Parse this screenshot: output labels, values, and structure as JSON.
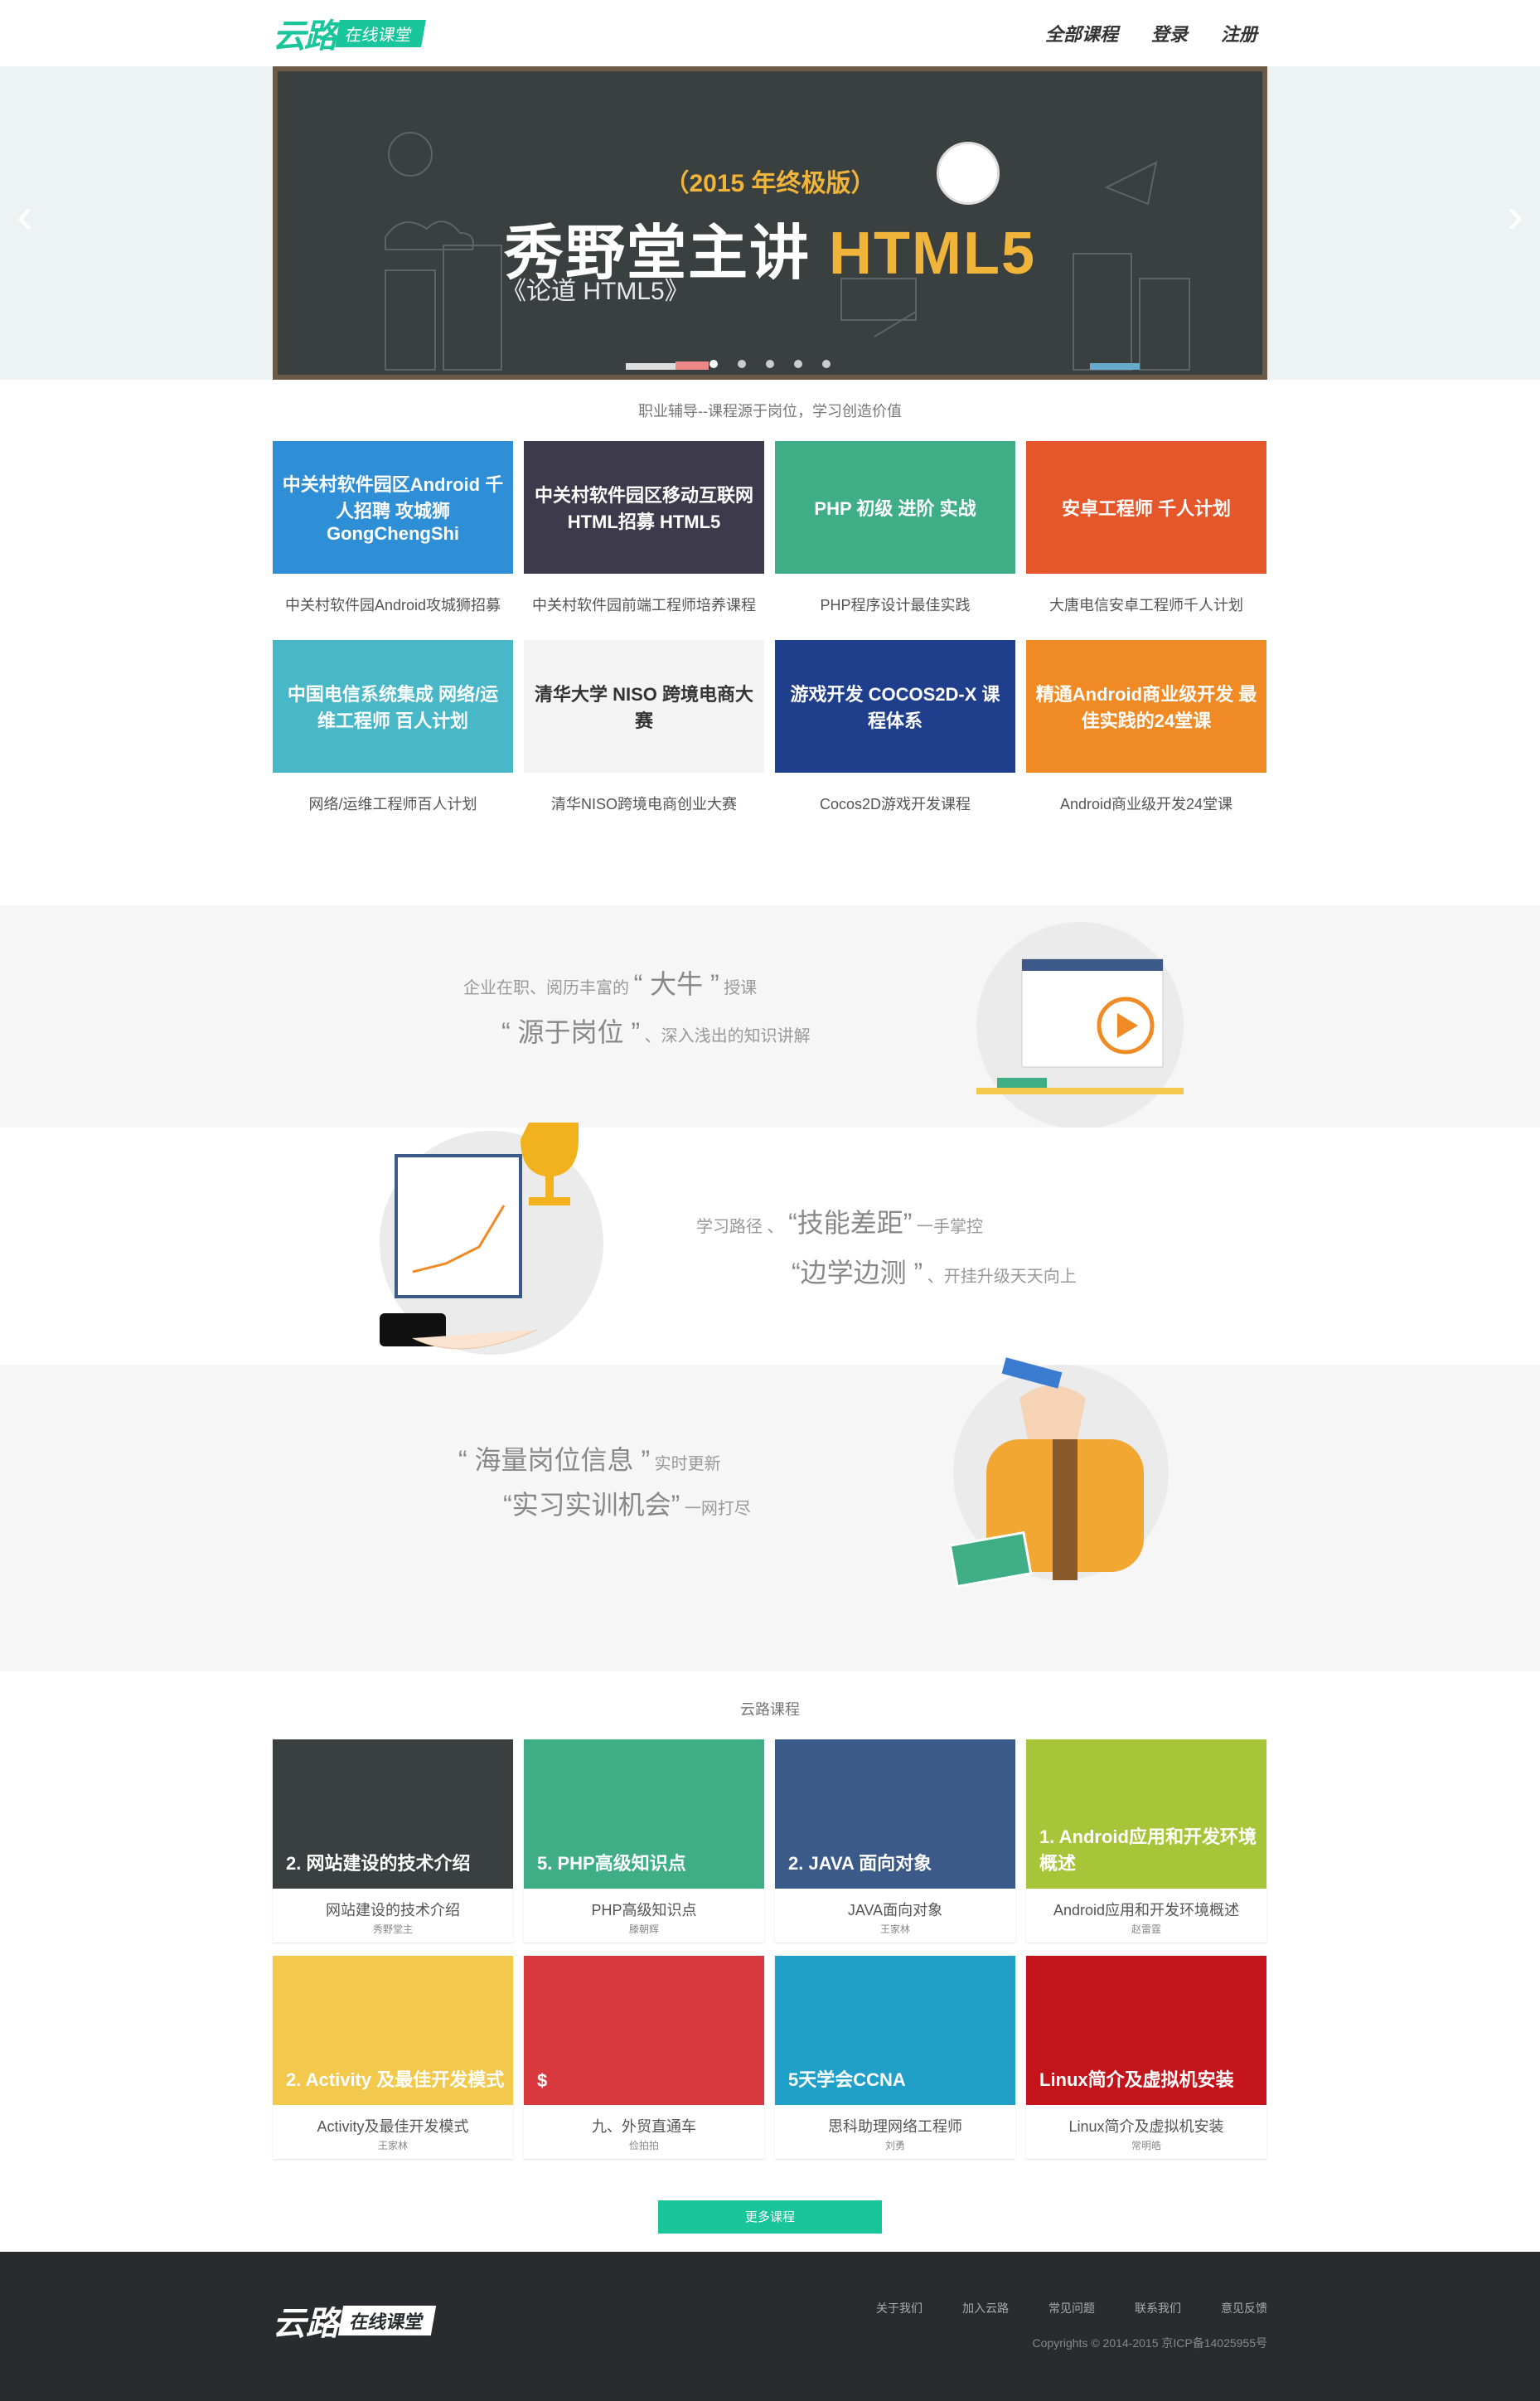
{
  "header": {
    "logo_main": "云路",
    "logo_tag": "在线课堂",
    "nav": [
      "全部课程",
      "登录",
      "注册"
    ]
  },
  "banner": {
    "edition": "（2015 年终极版）",
    "title_part1": "秀野堂主讲",
    "title_part2": "HTML5",
    "caption": "《论道 HTML5》",
    "dots": 5,
    "active_dot": 0
  },
  "career": {
    "title": "职业辅导--课程源于岗位，学习创造价值",
    "items": [
      {
        "label": "中关村软件园Android攻城狮招募",
        "thumb": "中关村软件园区Android 千人招聘 攻城狮 GongChengShi",
        "color": "#2e8fd6"
      },
      {
        "label": "中关村软件园前端工程师培养课程",
        "thumb": "中关村软件园区移动互联网HTML招募 HTML5",
        "color": "#3d3a4c"
      },
      {
        "label": "PHP程序设计最佳实践",
        "thumb": "PHP 初级 进阶 实战",
        "color": "#3fae86"
      },
      {
        "label": "大唐电信安卓工程师千人计划",
        "thumb": "安卓工程师 千人计划",
        "color": "#e5572a"
      },
      {
        "label": "网络/运维工程师百人计划",
        "thumb": "中国电信系统集成 网络/运维工程师 百人计划",
        "color": "#48b8c8"
      },
      {
        "label": "清华NISO跨境电商创业大赛",
        "thumb": "清华大学 NISO 跨境电商大赛",
        "color": "#f4f4f4"
      },
      {
        "label": "Cocos2D游戏开发课程",
        "thumb": "游戏开发 COCOS2D-X 课程体系",
        "color": "#1f3e8c"
      },
      {
        "label": "Android商业级开发24堂课",
        "thumb": "精通Android商业级开发 最佳实践的24堂课",
        "color": "#f08a24"
      }
    ]
  },
  "features": {
    "f1_line1_pre": "企业在职、阅历丰富的",
    "f1_line1_q": "“ 大牛 ”",
    "f1_line1_post": "授课",
    "f1_line2_q": "“ 源于岗位 ”",
    "f1_line2_post": "、深入浅出的知识讲解",
    "f2_line1_pre": "学习路径 、",
    "f2_line1_q": "“技能差距”",
    "f2_line1_post": "一手掌控",
    "f2_line2_q": "“边学边测 ”",
    "f2_line2_post": "、开挂升级天天向上",
    "f3_line1_q": "“ 海量岗位信息 ”",
    "f3_line1_post": "实时更新",
    "f3_line2_q": "“实习实训机会”",
    "f3_line2_post": "一网打尽"
  },
  "courses": {
    "title": "云路课程",
    "items": [
      {
        "name": "网站建设的技术介绍",
        "teacher": "秀野堂主",
        "thumb": "2. 网站建设的技术介绍",
        "color": "#3a3f40"
      },
      {
        "name": "PHP高级知识点",
        "teacher": "滕朝辉",
        "thumb": "5. PHP高级知识点",
        "color": "#3fae86"
      },
      {
        "name": "JAVA面向对象",
        "teacher": "王家林",
        "thumb": "2. JAVA 面向对象",
        "color": "#3b5a8a"
      },
      {
        "name": "Android应用和开发环境概述",
        "teacher": "赵雷霆",
        "thumb": "1. Android应用和开发环境概述",
        "color": "#a8c53a"
      },
      {
        "name": "Activity及最佳开发模式",
        "teacher": "王家林",
        "thumb": "2. Activity 及最佳开发模式",
        "color": "#f2c94c"
      },
      {
        "name": "九、外贸直通车",
        "teacher": "俭拍拍",
        "thumb": "$",
        "color": "#d8393e"
      },
      {
        "name": "思科助理网络工程师",
        "teacher": "刘勇",
        "thumb": "5天学会CCNA",
        "color": "#20a0c8"
      },
      {
        "name": "Linux简介及虚拟机安装",
        "teacher": "常明皓",
        "thumb": "Linux简介及虚拟机安装",
        "color": "#c4141b"
      }
    ],
    "more_label": "更多课程"
  },
  "footer": {
    "logo_main": "云路",
    "logo_tag": "在线课堂",
    "links": [
      "关于我们",
      "加入云路",
      "常见问题",
      "联系我们",
      "意见反馈"
    ],
    "copyright": "Copyrights © 2014-2015    京ICP备14025955号"
  }
}
